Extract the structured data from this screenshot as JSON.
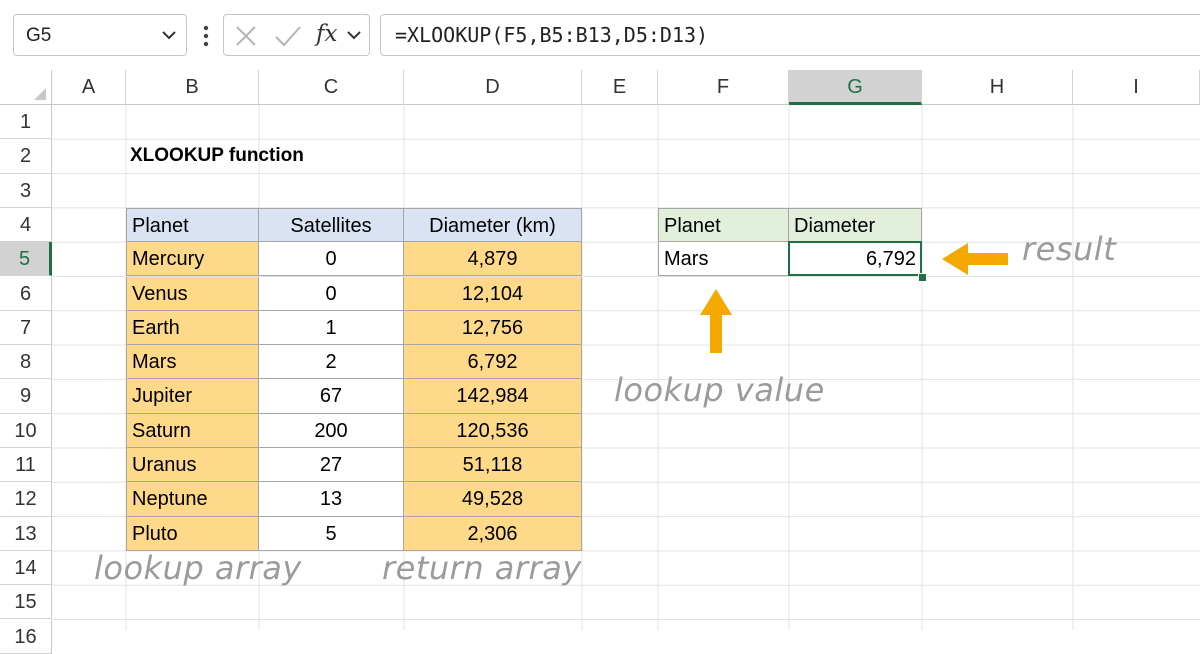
{
  "formula_bar": {
    "name_box": "G5",
    "fx_label": "fx",
    "formula": "=XLOOKUP(F5,B5:B13,D5:D13)"
  },
  "columns": [
    "A",
    "B",
    "C",
    "D",
    "E",
    "F",
    "G",
    "H",
    "I"
  ],
  "active_column": "G",
  "rows": [
    "1",
    "2",
    "3",
    "4",
    "5",
    "6",
    "7",
    "8",
    "9",
    "10",
    "11",
    "12",
    "13",
    "14",
    "15",
    "16"
  ],
  "active_row": "5",
  "sheet": {
    "title": "XLOOKUP function",
    "table": {
      "headers": [
        "Planet",
        "Satellites",
        "Diameter (km)"
      ],
      "rows": [
        [
          "Mercury",
          "0",
          "4,879"
        ],
        [
          "Venus",
          "0",
          "12,104"
        ],
        [
          "Earth",
          "1",
          "12,756"
        ],
        [
          "Mars",
          "2",
          "6,792"
        ],
        [
          "Jupiter",
          "67",
          "142,984"
        ],
        [
          "Saturn",
          "200",
          "120,536"
        ],
        [
          "Uranus",
          "27",
          "51,118"
        ],
        [
          "Neptune",
          "13",
          "49,528"
        ],
        [
          "Pluto",
          "5",
          "2,306"
        ]
      ]
    },
    "lookup": {
      "headers": [
        "Planet",
        "Diameter"
      ],
      "value": "Mars",
      "result": "6,792"
    }
  },
  "annotations": {
    "result": "result",
    "lookup_value": "lookup value",
    "lookup_array": "lookup array",
    "return_array": "return array"
  },
  "colors": {
    "header_blue": "#dae3f3",
    "header_green": "#e2efda",
    "highlight_orange": "#ffd98a",
    "arrow_orange": "#f5a800",
    "active_green": "#1e7145"
  }
}
